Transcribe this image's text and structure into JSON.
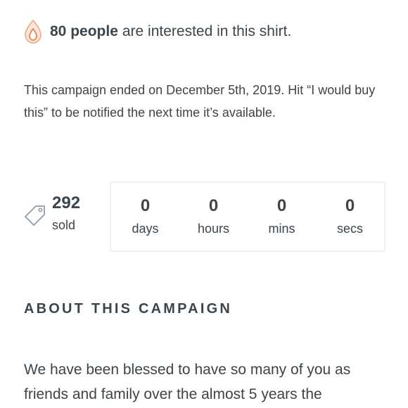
{
  "interest": {
    "count_text": "80 people",
    "suffix_text": "are interested in this shirt.",
    "icon": "flame-icon",
    "icon_color": "#f0a07a"
  },
  "campaign_status": {
    "message": "This campaign ended on December 5th, 2019. Hit “I would buy this” to be notified the next time it’s available."
  },
  "sales": {
    "icon": "tag-icon",
    "count": "292",
    "label": "sold"
  },
  "countdown": {
    "cells": [
      {
        "value": "0",
        "unit": "days"
      },
      {
        "value": "0",
        "unit": "hours"
      },
      {
        "value": "0",
        "unit": "mins"
      },
      {
        "value": "0",
        "unit": "secs"
      }
    ]
  },
  "about": {
    "heading": "ABOUT THIS CAMPAIGN",
    "text": "We have been blessed to have so many of you as friends and family over the almost 5 years the"
  }
}
